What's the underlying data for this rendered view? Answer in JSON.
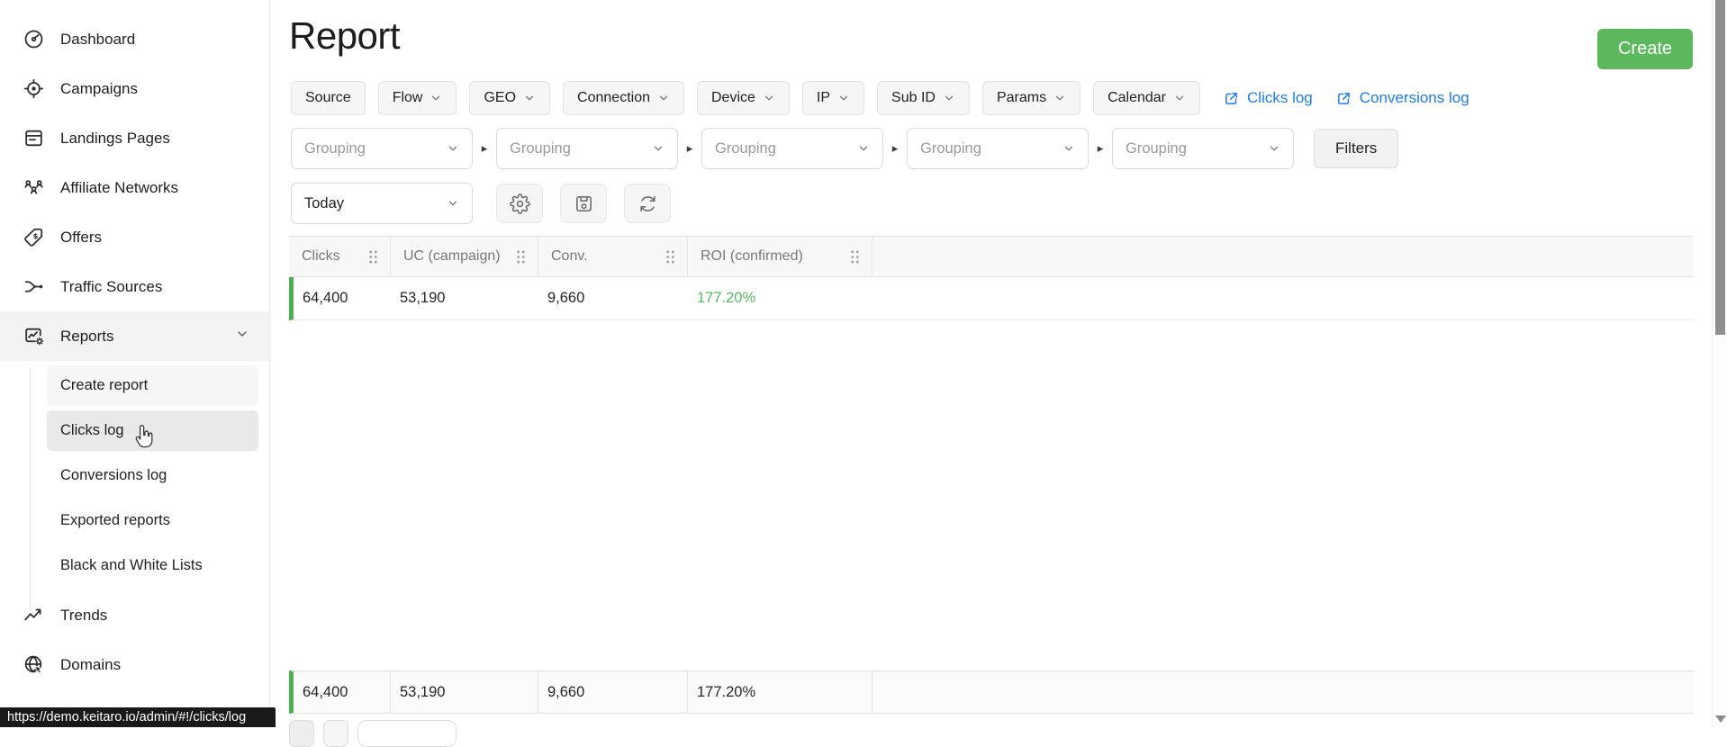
{
  "sidebar": {
    "items_top": [
      {
        "label": "Dashboard"
      },
      {
        "label": "Campaigns"
      },
      {
        "label": "Landings Pages"
      },
      {
        "label": "Affiliate Networks"
      },
      {
        "label": "Offers"
      },
      {
        "label": "Traffic Sources"
      }
    ],
    "reports": {
      "label": "Reports"
    },
    "reports_children": [
      {
        "label": "Create report"
      },
      {
        "label": "Clicks log"
      },
      {
        "label": "Conversions log"
      },
      {
        "label": "Exported reports"
      },
      {
        "label": "Black and White Lists"
      }
    ],
    "items_bottom": [
      {
        "label": "Trends"
      },
      {
        "label": "Domains"
      }
    ]
  },
  "header": {
    "title": "Report",
    "create_label": "Create"
  },
  "filters": {
    "chips": [
      {
        "label": "Source"
      },
      {
        "label": "Flow"
      },
      {
        "label": "GEO"
      },
      {
        "label": "Connection"
      },
      {
        "label": "Device"
      },
      {
        "label": "IP"
      },
      {
        "label": "Sub ID"
      },
      {
        "label": "Params"
      },
      {
        "label": "Calendar"
      }
    ],
    "links": [
      {
        "label": "Clicks log"
      },
      {
        "label": "Conversions log"
      }
    ]
  },
  "grouping": {
    "placeholder": "Grouping",
    "filters_label": "Filters"
  },
  "toolbar": {
    "date_range": "Today"
  },
  "table": {
    "columns": [
      {
        "label": "Clicks"
      },
      {
        "label": "UC (campaign)"
      },
      {
        "label": "Conv."
      },
      {
        "label": "ROI (confirmed)"
      }
    ],
    "rows": [
      {
        "clicks": "64,400",
        "uc": "53,190",
        "conv": "9,660",
        "roi": "177.20%"
      }
    ],
    "footer": {
      "clicks": "64,400",
      "uc": "53,190",
      "conv": "9,660",
      "roi": "177.20%"
    }
  },
  "statusbar": {
    "url": "https://demo.keitaro.io/admin/#!/clicks/log"
  },
  "colors": {
    "create_green": "#5cb85c",
    "roi_green": "#57b85f",
    "row_accent_green": "#4caf50",
    "link_blue": "#1d7ce8"
  }
}
